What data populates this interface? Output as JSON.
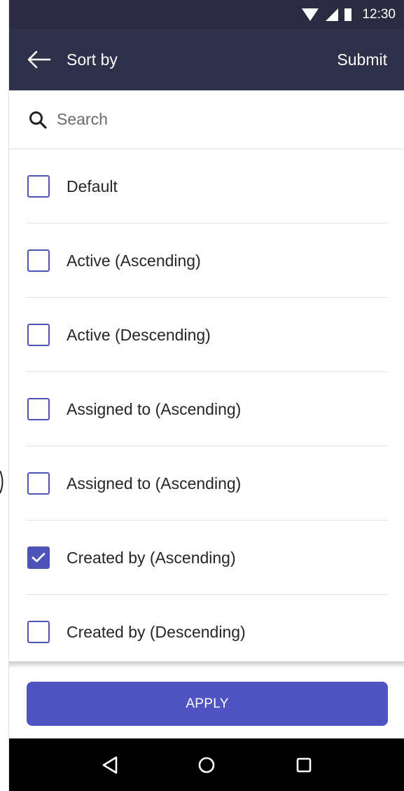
{
  "status_bar": {
    "time": "12:30",
    "icons": [
      "wifi-icon",
      "signal-icon",
      "battery-icon"
    ]
  },
  "app_bar": {
    "title": "Sort by",
    "back_icon": "arrow-left-icon",
    "submit_label": "Submit"
  },
  "search": {
    "placeholder": "Search",
    "icon": "search-icon"
  },
  "options": [
    {
      "label": "Default",
      "checked": false
    },
    {
      "label": "Active (Ascending)",
      "checked": false
    },
    {
      "label": "Active (Descending)",
      "checked": false
    },
    {
      "label": "Assigned to (Ascending)",
      "checked": false
    },
    {
      "label": "Assigned to (Ascending)",
      "checked": false
    },
    {
      "label": "Created by (Ascending)",
      "checked": true
    },
    {
      "label": "Created by (Descending)",
      "checked": false
    }
  ],
  "apply_label": "APPLY",
  "nav_bar": {
    "icons": [
      "back-triangle-icon",
      "home-circle-icon",
      "recents-square-icon"
    ]
  },
  "colors": {
    "status_bar": "#2a2a41",
    "app_bar": "#2f3049",
    "accent": "#4f54c2",
    "checkbox": "#4e53b8",
    "nav_bar": "#000000"
  }
}
